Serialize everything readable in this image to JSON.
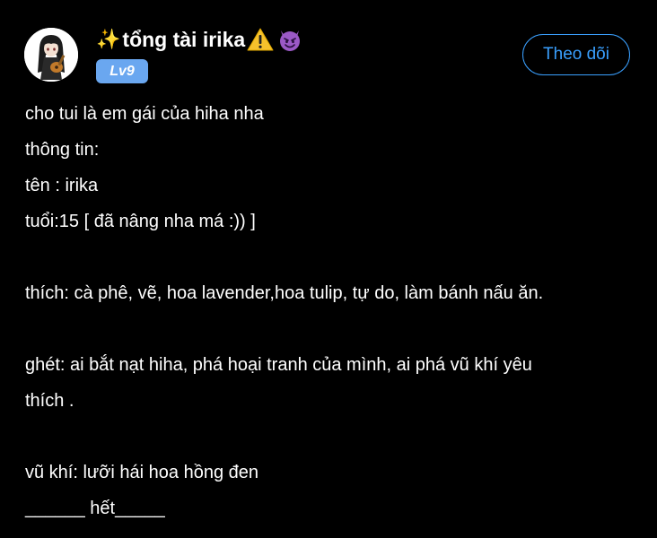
{
  "profile": {
    "name_prefix": "✨",
    "name_text": "tổng tài irika",
    "level": "Lv9",
    "avatar_icon": "anime-girl-avatar-icon",
    "name_icons": [
      "sparkles-icon",
      "warning-icon",
      "devil-face-icon"
    ]
  },
  "actions": {
    "follow_label": "Theo dõi"
  },
  "colors": {
    "background": "#000000",
    "accent": "#3aa0ff",
    "level_badge": "#6aa7f0",
    "text": "#ffffff"
  },
  "post": {
    "lines": [
      "cho tui là em gái của hiha nha",
      "thông tin:",
      "tên : irika",
      "tuổi:15 [ đã nâng nha má :)) ]",
      "",
      "thích: cà phê, vẽ, hoa lavender,hoa tulip, tự do, làm bánh nấu ăn.",
      "",
      "ghét: ai bắt nạt hiha, phá hoại tranh của mình, ai phá vũ khí yêu",
      "thích .",
      "",
      "vũ khí: lưỡi hái hoa hồng đen",
      "______ hết_____"
    ]
  }
}
